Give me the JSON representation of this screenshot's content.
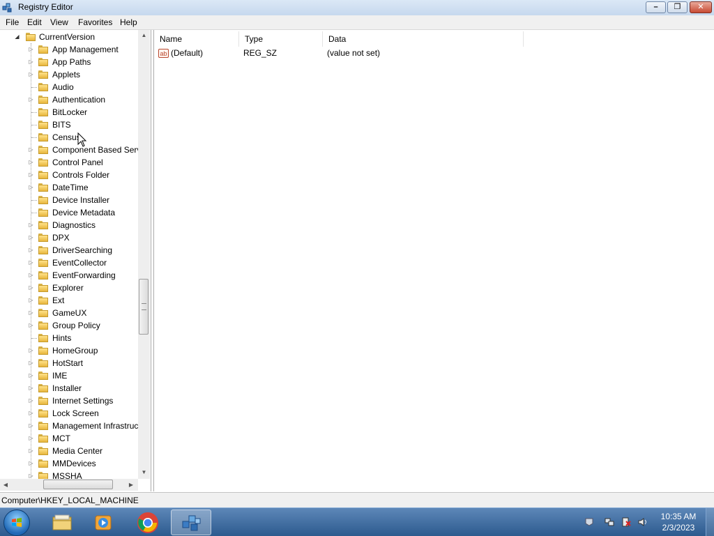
{
  "window": {
    "title": "Registry Editor"
  },
  "menu": [
    "File",
    "Edit",
    "View",
    "Favorites",
    "Help"
  ],
  "tree": {
    "parent": "CurrentVersion",
    "items": [
      {
        "label": "App Management",
        "expandable": true
      },
      {
        "label": "App Paths",
        "expandable": true
      },
      {
        "label": "Applets",
        "expandable": true
      },
      {
        "label": "Audio",
        "expandable": false
      },
      {
        "label": "Authentication",
        "expandable": true
      },
      {
        "label": "BitLocker",
        "expandable": false
      },
      {
        "label": "BITS",
        "expandable": false
      },
      {
        "label": "Census",
        "expandable": false
      },
      {
        "label": "Component Based Serv",
        "expandable": true
      },
      {
        "label": "Control Panel",
        "expandable": true
      },
      {
        "label": "Controls Folder",
        "expandable": true
      },
      {
        "label": "DateTime",
        "expandable": true
      },
      {
        "label": "Device Installer",
        "expandable": false
      },
      {
        "label": "Device Metadata",
        "expandable": false
      },
      {
        "label": "Diagnostics",
        "expandable": true
      },
      {
        "label": "DPX",
        "expandable": true
      },
      {
        "label": "DriverSearching",
        "expandable": true
      },
      {
        "label": "EventCollector",
        "expandable": true
      },
      {
        "label": "EventForwarding",
        "expandable": true
      },
      {
        "label": "Explorer",
        "expandable": true
      },
      {
        "label": "Ext",
        "expandable": true
      },
      {
        "label": "GameUX",
        "expandable": true
      },
      {
        "label": "Group Policy",
        "expandable": true
      },
      {
        "label": "Hints",
        "expandable": false
      },
      {
        "label": "HomeGroup",
        "expandable": true
      },
      {
        "label": "HotStart",
        "expandable": true
      },
      {
        "label": "IME",
        "expandable": true
      },
      {
        "label": "Installer",
        "expandable": true
      },
      {
        "label": "Internet Settings",
        "expandable": true
      },
      {
        "label": "Lock Screen",
        "expandable": true
      },
      {
        "label": "Management Infrastruc",
        "expandable": true
      },
      {
        "label": "MCT",
        "expandable": true
      },
      {
        "label": "Media Center",
        "expandable": true
      },
      {
        "label": "MMDevices",
        "expandable": true
      },
      {
        "label": "MSSHA",
        "expandable": true
      }
    ]
  },
  "list": {
    "columns": [
      "Name",
      "Type",
      "Data"
    ],
    "rows": [
      {
        "name": "(Default)",
        "type": "REG_SZ",
        "data": "(value not set)"
      }
    ]
  },
  "status": {
    "path": "Computer\\HKEY_LOCAL_MACHINE"
  },
  "taskbar": {
    "apps": [
      "start-button",
      "file-explorer",
      "media-player",
      "chrome",
      "registry-editor"
    ],
    "time": "10:35 AM",
    "date": "2/3/2023"
  }
}
